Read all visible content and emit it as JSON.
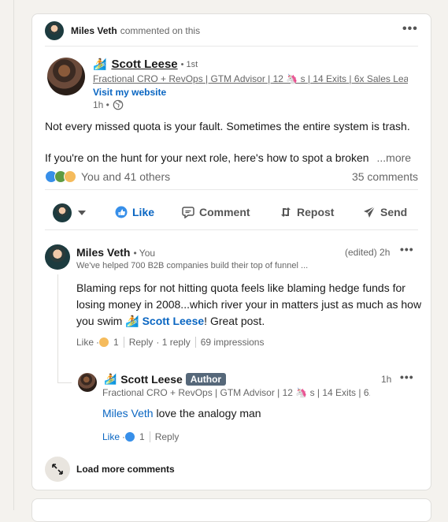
{
  "notice": {
    "actor": "Miles Veth",
    "text": "commented on this",
    "menu_icon": "•••"
  },
  "author": {
    "emoji": "🏄",
    "name": "Scott Leese",
    "degree": "• 1st",
    "headline": "Fractional CRO + RevOps | GTM Advisor | 12 🦄 s | 14 Exits | 6x Sales Lea...",
    "website": "Visit my website",
    "time": "1h •"
  },
  "post": {
    "line1": "Not every missed quota is your fault. Sometimes the entire system is trash.",
    "line2": "If you're on the hunt for your next role, here's how to spot a broken",
    "more": "...more"
  },
  "social": {
    "reactions_text": "You and 41 others",
    "comments_text": "35 comments"
  },
  "actions": {
    "like": "Like",
    "comment": "Comment",
    "repost": "Repost",
    "send": "Send"
  },
  "comment1": {
    "name": "Miles Veth",
    "you": "• You",
    "headline": "We've helped 700 B2B companies build their top of funnel ...",
    "edited_time": "(edited) 2h",
    "text_before": "Blaming reps for not hitting quota feels like blaming hedge funds for losing money in 2008...which river your in matters just as much as how you swim",
    "mention": "🏄 Scott Leese",
    "text_after": "! Great post.",
    "like": "Like",
    "dot": "·",
    "like_count": "1",
    "reply": "Reply",
    "reply_count": "· 1 reply",
    "impressions": "69 impressions"
  },
  "reply1": {
    "emoji": "🏄",
    "name": "Scott Leese",
    "badge": "Author",
    "headline": "Fractional CRO + RevOps | GTM Advisor | 12 🦄 s | 14 Exits | 6...",
    "time": "1h",
    "mention": "Miles Veth",
    "text": " love the analogy man",
    "like": "Like",
    "dot": "·",
    "like_count": "1",
    "reply": "Reply"
  },
  "load_more": "Load more comments",
  "colors": {
    "accent": "#0a66c2",
    "background": "#f4f2ee",
    "card": "#ffffff"
  }
}
